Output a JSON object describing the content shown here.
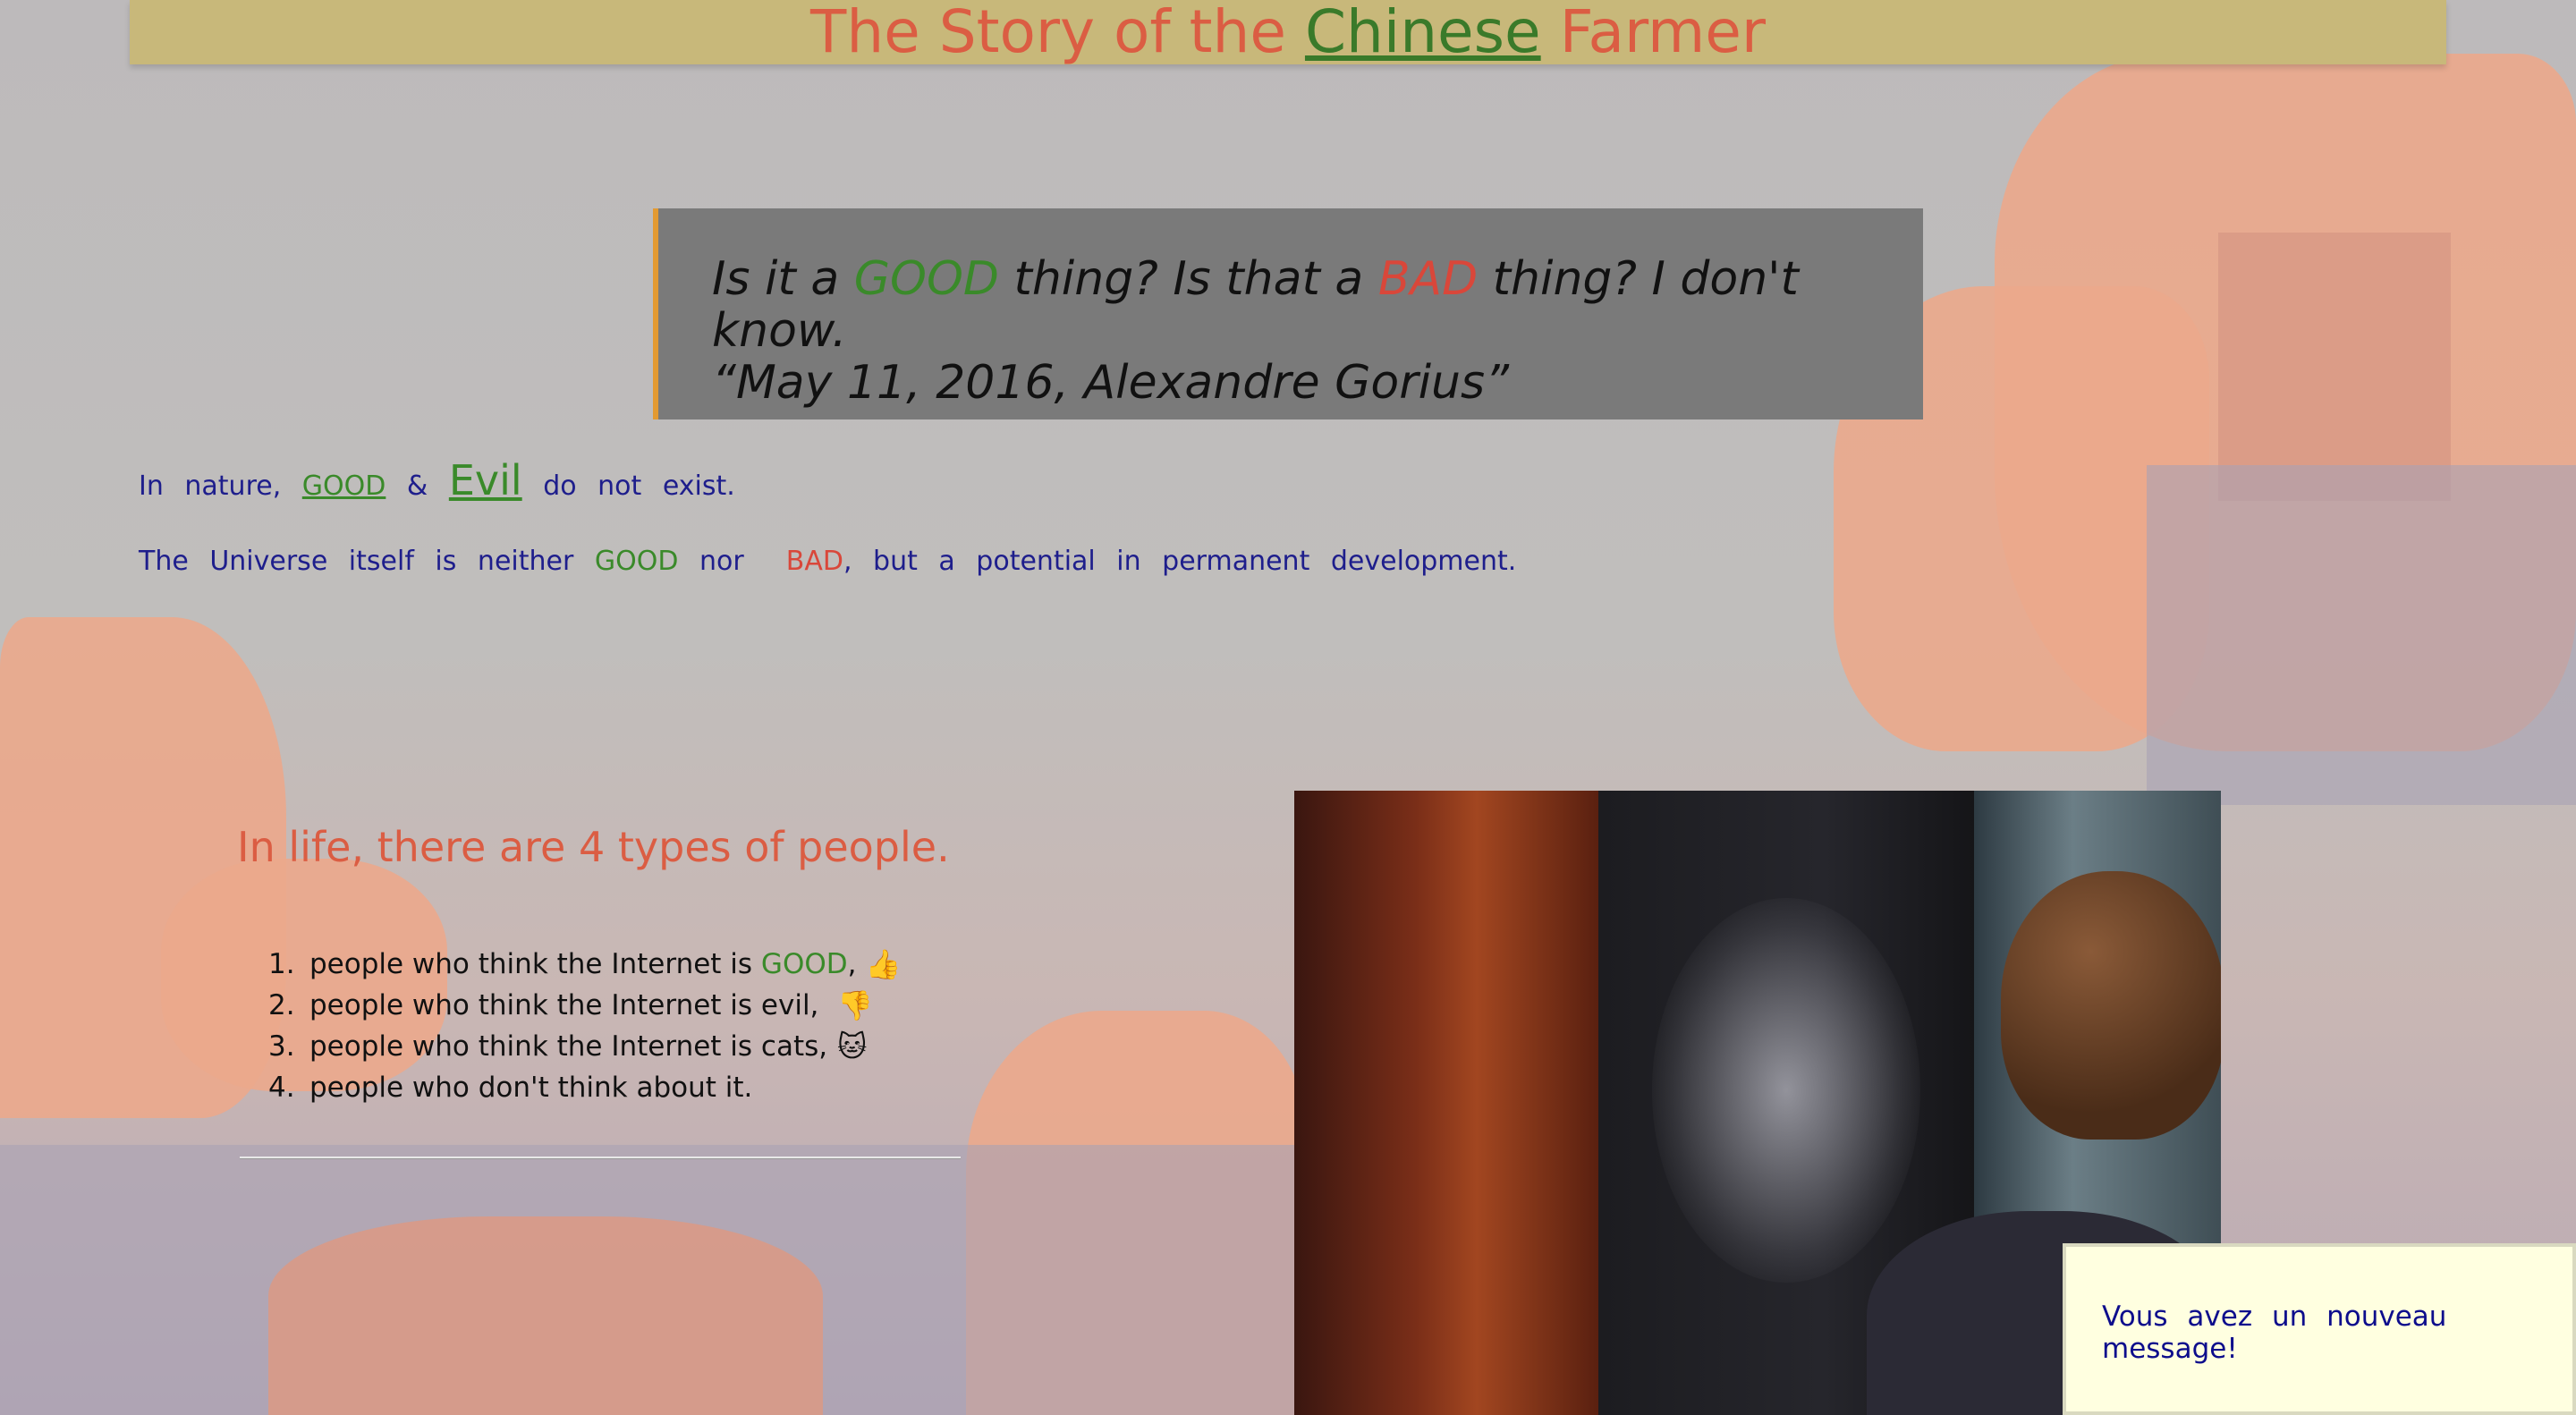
{
  "header": {
    "title_before": "The Story of the ",
    "title_link": "Chinese",
    "title_after": " Farmer"
  },
  "quote": {
    "line1_a": "Is it a ",
    "good": "GOOD",
    "line1_b": " thing? Is that a ",
    "bad": "BAD",
    "line1_c": " thing? I don't know.",
    "line2": "“May 11, 2016, Alexandre Gorius”"
  },
  "intro": {
    "p1_a": "In nature, ",
    "p1_good": "GOOD",
    "p1_amp": " & ",
    "p1_evil": "Evil",
    "p1_b": " do not exist.",
    "p2_a": "The Universe itself is neither ",
    "p2_good": "GOOD",
    "p2_nor": " nor  ",
    "p2_bad": "BAD",
    "p2_b": ", but a potential in permanent development."
  },
  "types": {
    "title": "In life, there are 4 types of people.",
    "items": [
      {
        "num": "1.",
        "text_a": "people who think the Internet is ",
        "good": "GOOD",
        "text_b": ",",
        "icon": "thumbs-up-icon"
      },
      {
        "num": "2.",
        "text_a": "people who think the Internet is evil,",
        "icon": "thumbs-down-icon"
      },
      {
        "num": "3.",
        "text_a": "people who think the Internet is cats,",
        "icon": "cat-icon"
      },
      {
        "num": "4.",
        "text_a": "people who don't think about it."
      }
    ]
  },
  "notification": {
    "text": "Vous avez un nouveau message!"
  },
  "colors": {
    "header_bg": "#c8b87a",
    "accent_red": "#db5d43",
    "good_green": "#3a8a2a",
    "bad_red": "#d9473a",
    "text_navy": "#1e1e8c"
  }
}
